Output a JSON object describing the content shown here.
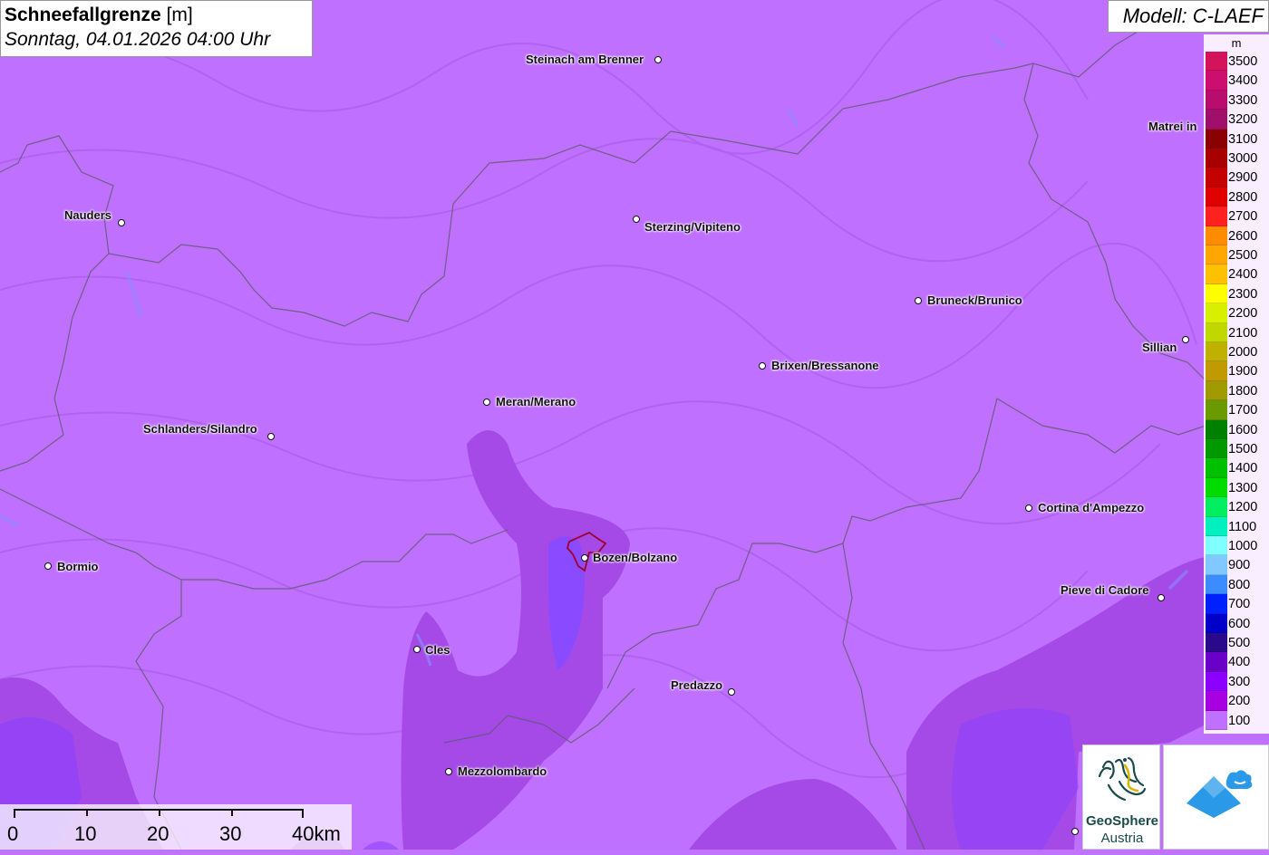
{
  "title": {
    "main": "Schneefallgrenze",
    "unit": "[m]",
    "datetime": "Sonntag, 04.01.2026 04:00 Uhr"
  },
  "model": "Modell: C-LAEF",
  "legend": {
    "unit": "m",
    "items": [
      {
        "label": "3500",
        "color": "#d4145a"
      },
      {
        "label": "3400",
        "color": "#cc0f6e"
      },
      {
        "label": "3300",
        "color": "#b80c6e"
      },
      {
        "label": "3200",
        "color": "#a0106a"
      },
      {
        "label": "3100",
        "color": "#8b0000"
      },
      {
        "label": "3000",
        "color": "#a80000"
      },
      {
        "label": "2900",
        "color": "#c40000"
      },
      {
        "label": "2800",
        "color": "#e00000"
      },
      {
        "label": "2700",
        "color": "#ff2020"
      },
      {
        "label": "2600",
        "color": "#ff8c00"
      },
      {
        "label": "2500",
        "color": "#ffa600"
      },
      {
        "label": "2400",
        "color": "#ffc000"
      },
      {
        "label": "2300",
        "color": "#ffff00"
      },
      {
        "label": "2200",
        "color": "#d8f000"
      },
      {
        "label": "2100",
        "color": "#c0d800"
      },
      {
        "label": "2000",
        "color": "#c0b000"
      },
      {
        "label": "1900",
        "color": "#c09a00"
      },
      {
        "label": "1800",
        "color": "#a09a00"
      },
      {
        "label": "1700",
        "color": "#6a9a00"
      },
      {
        "label": "1600",
        "color": "#008000"
      },
      {
        "label": "1500",
        "color": "#009a00"
      },
      {
        "label": "1400",
        "color": "#00c000"
      },
      {
        "label": "1300",
        "color": "#00dc00"
      },
      {
        "label": "1200",
        "color": "#00ee60"
      },
      {
        "label": "1100",
        "color": "#00f0c0"
      },
      {
        "label": "1000",
        "color": "#80ffff"
      },
      {
        "label": "900",
        "color": "#80c8ff"
      },
      {
        "label": "800",
        "color": "#3a8cff"
      },
      {
        "label": "700",
        "color": "#0020ff"
      },
      {
        "label": "600",
        "color": "#0000c8"
      },
      {
        "label": "500",
        "color": "#2a0a8a"
      },
      {
        "label": "400",
        "color": "#6a00c8"
      },
      {
        "label": "300",
        "color": "#8c00ff"
      },
      {
        "label": "200",
        "color": "#a800e0"
      },
      {
        "label": "100",
        "color": "#c070ff"
      }
    ]
  },
  "cities": [
    {
      "name": "Steinach am Brenner"
    },
    {
      "name": "Matrei in"
    },
    {
      "name": "Nauders"
    },
    {
      "name": "Sterzing/Vipiteno"
    },
    {
      "name": "Bruneck/Brunico"
    },
    {
      "name": "Sillian"
    },
    {
      "name": "Brixen/Bressanone"
    },
    {
      "name": "Meran/Merano"
    },
    {
      "name": "Schlanders/Silandro"
    },
    {
      "name": "Cortina d'Ampezzo"
    },
    {
      "name": "Bormio"
    },
    {
      "name": "Bozen/Bolzano"
    },
    {
      "name": "Pieve di Cadore"
    },
    {
      "name": "Cles"
    },
    {
      "name": "Predazzo"
    },
    {
      "name": "Mezzolombardo"
    }
  ],
  "scale": {
    "labels": [
      "0",
      "10",
      "20",
      "30",
      "40km"
    ]
  },
  "logos": {
    "geosphere_line1": "GeoSphere",
    "geosphere_line2": "Austria"
  }
}
